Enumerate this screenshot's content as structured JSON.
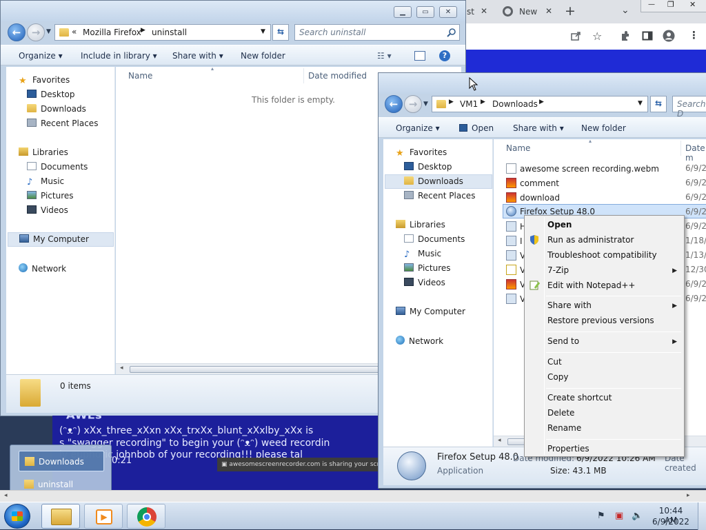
{
  "chrome": {
    "tab_fragment": "st",
    "tab_new_label": "New",
    "new_tab_symbol": "+",
    "tab_list_symbol": "⌄",
    "close_symbol": "✕",
    "min_symbol": "—",
    "restore_symbol": "❐",
    "icons": [
      "share-icon",
      "bookmark-star-icon",
      "extensions-icon",
      "side-panel-icon",
      "profile-icon",
      "menu-icon"
    ],
    "accent": "#1f2bd6"
  },
  "win1": {
    "address": {
      "overflow": "«",
      "crumbs": [
        "Mozilla Firefox",
        "uninstall"
      ]
    },
    "search_placeholder": "Search uninstall",
    "commands": {
      "organize": "Organize",
      "include": "Include in library",
      "share": "Share with",
      "new_folder": "New folder"
    },
    "nav": {
      "favorites": "Favorites",
      "desktop": "Desktop",
      "downloads": "Downloads",
      "recent": "Recent Places",
      "libraries": "Libraries",
      "documents": "Documents",
      "music": "Music",
      "pictures": "Pictures",
      "videos": "Videos",
      "computer": "My Computer",
      "network": "Network"
    },
    "columns": {
      "name": "Name",
      "date": "Date modified"
    },
    "empty_message": "This folder is empty.",
    "status": "0 items"
  },
  "win2": {
    "address": {
      "crumbs": [
        "VM1",
        "Downloads"
      ]
    },
    "search_placeholder": "Search D",
    "commands": {
      "organize": "Organize",
      "open": "Open",
      "share": "Share with",
      "new_folder": "New folder"
    },
    "nav": {
      "favorites": "Favorites",
      "desktop": "Desktop",
      "downloads": "Downloads",
      "recent": "Recent Places",
      "libraries": "Libraries",
      "documents": "Documents",
      "music": "Music",
      "pictures": "Pictures",
      "videos": "Videos",
      "computer": "My Computer",
      "network": "Network"
    },
    "columns": {
      "name": "Name",
      "date": "Date m"
    },
    "files": [
      {
        "name": "awesome screen recording.webm",
        "date": "6/9/20",
        "icon": "webm-file-icon"
      },
      {
        "name": "comment",
        "date": "6/9/20",
        "icon": "image-file-icon"
      },
      {
        "name": "download",
        "date": "6/9/20",
        "icon": "image-file-icon"
      },
      {
        "name": "Firefox Setup 48.0",
        "date": "6/9/20",
        "icon": "installer-icon"
      },
      {
        "name": "H",
        "date": "6/9/20",
        "icon": "app-file-icon"
      },
      {
        "name": "I",
        "date": "1/18/2",
        "icon": "app-file-icon"
      },
      {
        "name": "V",
        "date": "1/13/2",
        "icon": "app-file-icon"
      },
      {
        "name": "V",
        "date": "12/30,",
        "icon": "app-file-icon"
      },
      {
        "name": "V",
        "date": "6/9/20",
        "icon": "app-file-icon"
      },
      {
        "name": "V",
        "date": "6/9/20",
        "icon": "app-file-icon"
      }
    ],
    "details": {
      "name": "Firefox Setup 48.0",
      "type": "Application",
      "date_label": "Date modified:",
      "date_value": "6/9/2022 10:26 AM",
      "size": "Size: 43.1 MB",
      "created_fragment": "Date created"
    }
  },
  "context_menu": {
    "open": "Open",
    "run_admin": "Run as administrator",
    "troubleshoot": "Troubleshoot compatibility",
    "sevenzip": "7-Zip",
    "notepad": "Edit with Notepad++",
    "share_with": "Share with",
    "restore": "Restore previous versions",
    "send_to": "Send to",
    "cut": "Cut",
    "copy": "Copy",
    "create_shortcut": "Create shortcut",
    "delete": "Delete",
    "rename": "Rename",
    "properties": "Properties",
    "submenu_arrow": "▶"
  },
  "video": {
    "line1": "(ᵔᴥᵔ) xXx_three_xXxn xXx_trxXx_blunt_xXxlby_xXx is",
    "line2": "s \"swagger recording\" to begin your (ᵔᴥᵔ) weed recordin",
    "line3": "ly euphoric johnbob of your recording!!! please tal",
    "time": "0:21",
    "share_notice": "awesomescreenrecorder.com is sharing your scre"
  },
  "jumplist": {
    "items": [
      "Downloads",
      "uninstall"
    ]
  },
  "taskbar": {
    "time": "10:44 AM",
    "date": "6/9/2022"
  }
}
